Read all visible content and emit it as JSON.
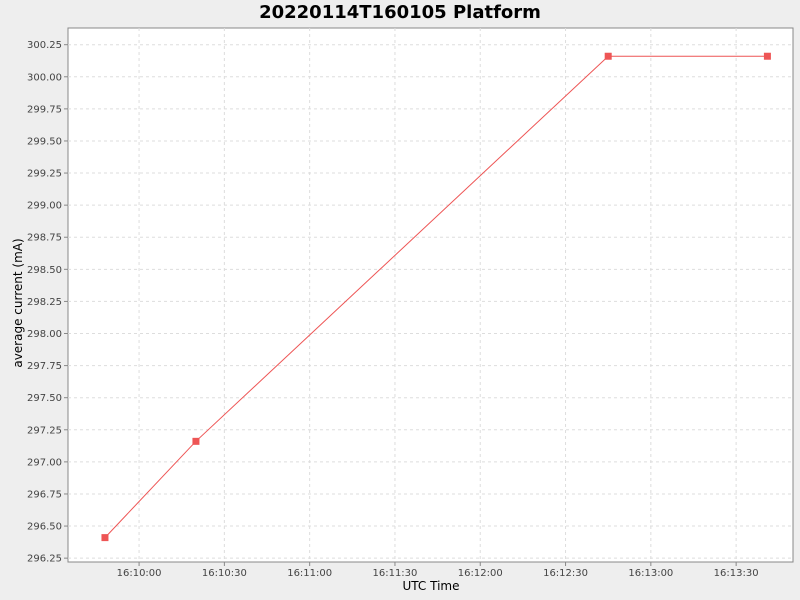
{
  "chart_data": {
    "type": "line",
    "title": "20220114T160105 Platform",
    "xlabel": "UTC Time",
    "ylabel": "average current (mA)",
    "x_tick_labels": [
      "16:10:00",
      "16:10:30",
      "16:11:00",
      "16:11:30",
      "16:12:00",
      "16:12:30",
      "16:13:00",
      "16:13:30"
    ],
    "y_tick_labels": [
      "296.25",
      "296.50",
      "296.75",
      "297.00",
      "297.25",
      "297.50",
      "297.75",
      "298.00",
      "298.25",
      "298.50",
      "298.75",
      "299.00",
      "299.25",
      "299.50",
      "299.75",
      "300.00",
      "300.25"
    ],
    "xlim": [
      "16:09:35",
      "16:13:50"
    ],
    "ylim": [
      296.22,
      300.38
    ],
    "grid": true,
    "legend": "none",
    "series": [
      {
        "color": "#ee5555",
        "marker": "square",
        "points": [
          {
            "x": "16:09:48",
            "y": 296.41
          },
          {
            "x": "16:10:20",
            "y": 297.16
          },
          {
            "x": "16:12:45",
            "y": 300.16
          },
          {
            "x": "16:13:41",
            "y": 300.16
          }
        ]
      }
    ]
  }
}
